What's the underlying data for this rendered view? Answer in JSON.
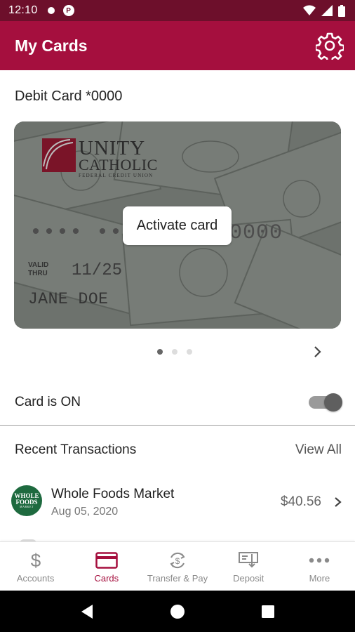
{
  "status_bar": {
    "time": "12:10",
    "notification_icons": [
      "dot-icon",
      "pill-icon"
    ],
    "system_icons": [
      "wifi-icon",
      "cellular-icon",
      "battery-icon"
    ]
  },
  "app_bar": {
    "title": "My Cards",
    "settings_icon": "gear-icon"
  },
  "card_section": {
    "heading": "Debit Card *0000",
    "card": {
      "brand_line1": "UNITY",
      "brand_line2": "CATHOLIC",
      "brand_line3": "FEDERAL CREDIT UNION",
      "number": "•••• •••• •••• 0000",
      "valid_thru_line1": "VALID",
      "valid_thru_line2": "THRU",
      "expiry": "11/25",
      "holder": "JANE DOE"
    },
    "activate_label": "Activate card",
    "pager": {
      "count": 3,
      "active_index": 0
    }
  },
  "card_toggle": {
    "label": "Card is ON",
    "on": true
  },
  "recent": {
    "title": "Recent Transactions",
    "view_all": "View All",
    "transactions": [
      {
        "logo_line1": "WHOLE",
        "logo_line2": "FOODS",
        "logo_line3": "MARKET",
        "merchant": "Whole Foods Market",
        "date": "Aug 05, 2020",
        "amount": "$40.56"
      }
    ]
  },
  "bottom_nav": {
    "items": [
      {
        "label": "Accounts",
        "icon": "dollar-icon",
        "active": false
      },
      {
        "label": "Cards",
        "icon": "card-icon",
        "active": true
      },
      {
        "label": "Transfer & Pay",
        "icon": "transfer-icon",
        "active": false
      },
      {
        "label": "Deposit",
        "icon": "deposit-check-icon",
        "active": false
      },
      {
        "label": "More",
        "icon": "more-icon",
        "active": false
      }
    ]
  },
  "colors": {
    "status_bar": "#6d0f2b",
    "brand": "#a50f3e",
    "active_nav": "#a50f3e",
    "merchant_logo": "#1e6a3f"
  }
}
